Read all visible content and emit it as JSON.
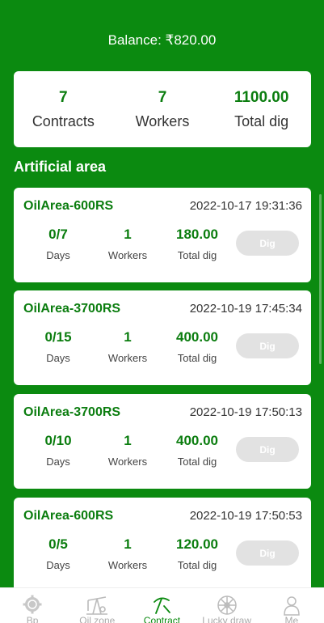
{
  "header": {
    "balance": "Balance: ₹820.00"
  },
  "summary": [
    {
      "value": "7",
      "label": "Contracts"
    },
    {
      "value": "7",
      "label": "Workers"
    },
    {
      "value": "1100.00",
      "label": "Total dig"
    }
  ],
  "section_title": "Artificial area",
  "stat_labels": {
    "days": "Days",
    "workers": "Workers",
    "total": "Total dig"
  },
  "dig_label": "Dig",
  "contracts": [
    {
      "name": "OilArea-600RS",
      "time": "2022-10-17 19:31:36",
      "days": "0/7",
      "workers": "1",
      "total": "180.00"
    },
    {
      "name": "OilArea-3700RS",
      "time": "2022-10-19 17:45:34",
      "days": "0/15",
      "workers": "1",
      "total": "400.00"
    },
    {
      "name": "OilArea-3700RS",
      "time": "2022-10-19 17:50:13",
      "days": "0/10",
      "workers": "1",
      "total": "400.00"
    },
    {
      "name": "OilArea-600RS",
      "time": "2022-10-19 17:50:53",
      "days": "0/5",
      "workers": "1",
      "total": "120.00"
    }
  ],
  "nav": [
    {
      "label": "Bp",
      "icon": "gear-coin-icon"
    },
    {
      "label": "Oil zone",
      "icon": "oil-pump-icon"
    },
    {
      "label": "Contract",
      "icon": "pickaxe-icon",
      "active": true
    },
    {
      "label": "Lucky draw",
      "icon": "wheel-icon"
    },
    {
      "label": "Me",
      "icon": "person-icon"
    }
  ],
  "colors": {
    "primary": "#0b8a10",
    "accent_text": "#0b7d0f",
    "disabled_button": "#e2e2e2"
  }
}
